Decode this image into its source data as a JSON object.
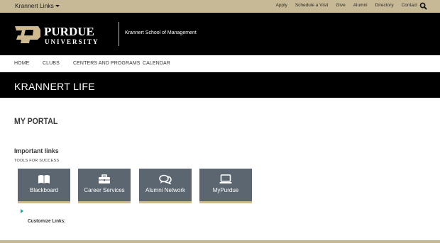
{
  "topbar": {
    "krannert_links": "Krannert Links",
    "utility_links": [
      "Apply",
      "Schedule a Visit",
      "Give",
      "Alumni",
      "Directory",
      "Contact"
    ],
    "search_icon": "search-icon"
  },
  "brand": {
    "logo_word_top": "PURDUE",
    "logo_word_bottom": "UNIVERSITY",
    "school_name": "Krannert School of Management"
  },
  "nav": {
    "items": [
      "HOME",
      "CLUBS",
      "CENTERS AND PROGRAMS",
      "CALENDAR"
    ]
  },
  "hero": {
    "title": "KRANNERT LIFE"
  },
  "portal": {
    "title": "MY PORTAL",
    "links_heading": "Important links",
    "links_subheading": "TOOLS FOR SUCCESS",
    "tiles": [
      {
        "label": "Blackboard",
        "icon": "book-icon"
      },
      {
        "label": "Career Services",
        "icon": "briefcase-icon"
      },
      {
        "label": "Alumni Network",
        "icon": "chat-icon"
      },
      {
        "label": "MyPurdue",
        "icon": "monitor-icon"
      }
    ],
    "customize_label": "Customize Links:"
  },
  "colors": {
    "gold": "#cfb991",
    "tile_gray": "#5b6670",
    "black": "#000000",
    "teal": "#19a49c"
  }
}
